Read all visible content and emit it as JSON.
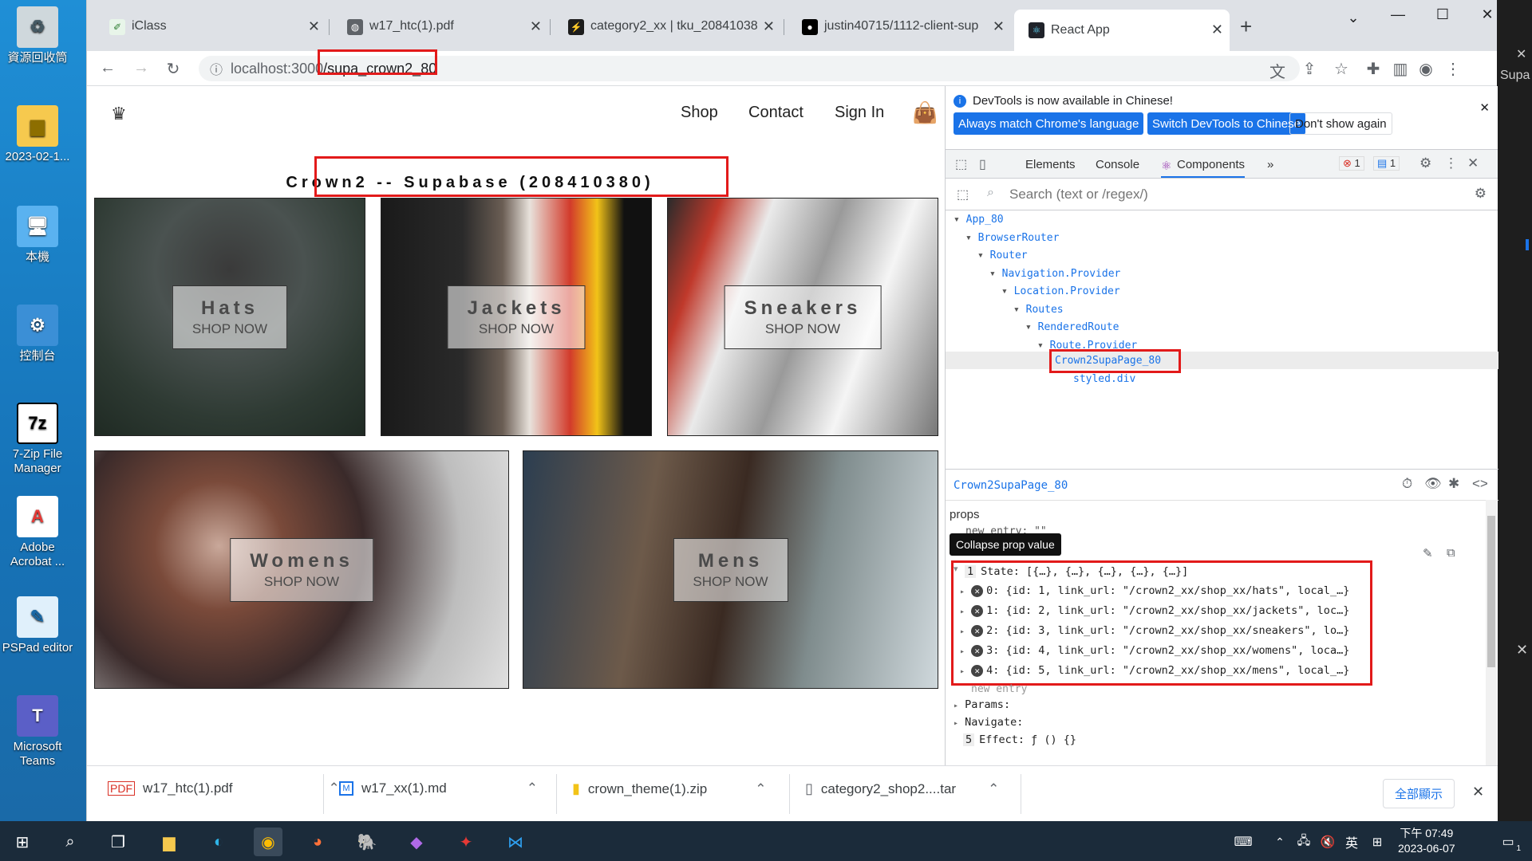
{
  "desktop": {
    "icons": [
      {
        "label": "資源回收筒",
        "icon": "recycle-bin-icon",
        "color": "#cfd8dc"
      },
      {
        "label": "2023-02-1...",
        "icon": "folder-icon",
        "color": "#f6c94e"
      },
      {
        "label": "本機",
        "icon": "computer-icon",
        "color": "#5ab2f0"
      },
      {
        "label": "控制台",
        "icon": "control-panel-icon",
        "color": "#3b8fd6"
      },
      {
        "label": "7-Zip File Manager",
        "icon": "7zip-icon",
        "color": "#ffffff"
      },
      {
        "label": "Adobe Acrobat ...",
        "icon": "acrobat-icon",
        "color": "#e53935"
      },
      {
        "label": "PSPad editor",
        "icon": "pspad-icon",
        "color": "#4aa3df"
      },
      {
        "label": "Microsoft Teams",
        "icon": "teams-icon",
        "color": "#5b5fc7"
      }
    ]
  },
  "browser": {
    "tabs": [
      {
        "title": "iClass",
        "icon": "iclass-icon"
      },
      {
        "title": "w17_htc(1).pdf",
        "icon": "globe-icon"
      },
      {
        "title": "category2_xx | tku_20841038",
        "icon": "supabase-icon"
      },
      {
        "title": "justin40715/1112-client-sup",
        "icon": "github-icon"
      },
      {
        "title": "React App",
        "icon": "react-icon"
      }
    ],
    "url_host": "localhost:3000",
    "url_path": "/supa_crown2_80"
  },
  "page": {
    "nav": [
      "Shop",
      "Contact",
      "Sign In"
    ],
    "title": "Crown2 -- Supabase (208410380)",
    "categories": [
      {
        "title": "Hats",
        "sub": "SHOP NOW"
      },
      {
        "title": "Jackets",
        "sub": "SHOP NOW"
      },
      {
        "title": "Sneakers",
        "sub": "SHOP NOW"
      },
      {
        "title": "Womens",
        "sub": "SHOP NOW"
      },
      {
        "title": "Mens",
        "sub": "SHOP NOW"
      }
    ]
  },
  "devtools": {
    "info": "DevTools is now available in Chinese!",
    "btn_match": "Always match Chrome's language",
    "btn_switch": "Switch DevTools to Chinese",
    "btn_dont": "Don't show again",
    "tabs": [
      "Elements",
      "Console",
      "Components"
    ],
    "err_count": "1",
    "msg_count": "1",
    "search_placeholder": "Search (text or /regex/)",
    "tree": [
      "App_80",
      "BrowserRouter",
      "Router",
      "Navigation.Provider",
      "Location.Provider",
      "Routes",
      "RenderedRoute",
      "Route.Provider",
      "Crown2SupaPage_80",
      "styled.div"
    ],
    "selected": "Crown2SupaPage_80",
    "props_label": "props",
    "new_entry": "new entry: \"\"",
    "tooltip": "Collapse prop value",
    "hooks": {
      "state_head": "State: [{…}, {…}, {…}, {…}, {…}]",
      "rows": [
        "0: {id: 1, link_url: \"/crown2_xx/shop_xx/hats\", local_…}",
        "1: {id: 2, link_url: \"/crown2_xx/shop_xx/jackets\", loc…}",
        "2: {id: 3, link_url: \"/crown2_xx/shop_xx/sneakers\", lo…}",
        "3: {id: 4, link_url: \"/crown2_xx/shop_xx/womens\", loca…}",
        "4: {id: 5, link_url: \"/crown2_xx/shop_xx/mens\", local_…}"
      ],
      "new_entry2": "new entry",
      "params": "Params:",
      "navigate": "Navigate:",
      "effect_num": "5",
      "effect": "Effect: ƒ () {}"
    }
  },
  "downloads": {
    "items": [
      "w17_htc(1).pdf",
      "w17_xx(1).md",
      "crown_theme(1).zip",
      "category2_shop2....tar"
    ],
    "show_all": "全部顯示"
  },
  "taskbar": {
    "time": "下午 07:49",
    "date": "2023-06-07",
    "ime": "英",
    "notif": "1"
  },
  "right_strip": {
    "label": "Supa"
  }
}
